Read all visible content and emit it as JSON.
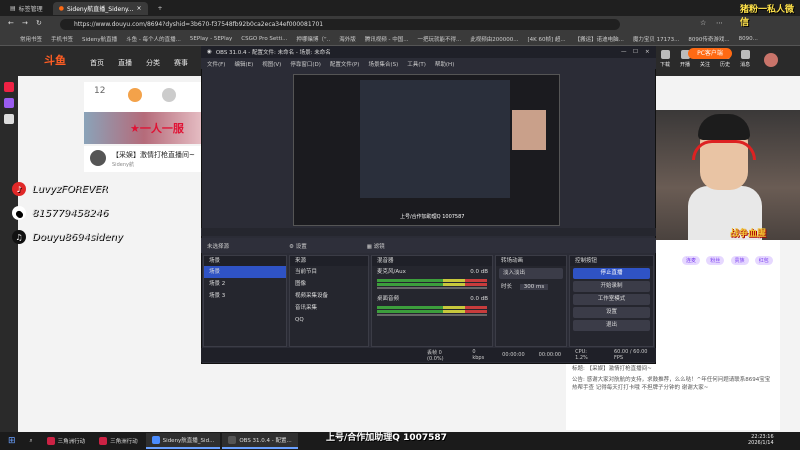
{
  "browser": {
    "tabs": [
      {
        "label": "标签管理"
      },
      {
        "label": "Sideny航直播_Sideny..."
      }
    ],
    "url": "https://www.douyu.com/8694?dyshid=3b670-f37548fb92b0ca2eca34ef000081701",
    "bookmarks": [
      "常用书签",
      "手机书签",
      "Sideny航直播",
      "斗鱼 - 每个人的直播...",
      "5EPlay - 5EPlay",
      "CSGO Pro Setti...",
      "押哪赌博（“..",
      "海外版",
      "腾讯视频 - 中国...",
      "一把玩就能不得...",
      "此视频由200000...",
      "[4K 60帧] 超...",
      "【搬运】诺迪电脑...",
      "魔力宝贝 17173...",
      "8090传奇游戏...",
      "8090..."
    ]
  },
  "site": {
    "logo": "斗鱼",
    "nav": [
      "首页",
      "直播",
      "分类",
      "赛事"
    ],
    "right_nav": [
      "下载",
      "开播",
      "关注",
      "历史",
      "消息"
    ],
    "pc_button": "PC客户端",
    "room_level": "12",
    "room_title": "【采娱】激情打枪直播间~",
    "host_name": "Sideny航",
    "banner_text": "★一人一服"
  },
  "overlay": {
    "top_right": "猪粉一私人微信",
    "socials": [
      {
        "icon": "netease-music-icon",
        "text": "LuvyzFOREVER",
        "color": "#e02828"
      },
      {
        "icon": "penguin-icon",
        "text": "815779458246",
        "color": "#ffffff"
      },
      {
        "icon": "tiktok-icon",
        "text": "Douyu8694sideny",
        "color": "#111111"
      }
    ],
    "cam_text": "战争血腥",
    "bottom": "上号/合作加助理Q 1007587"
  },
  "obs": {
    "title": "OBS 31.0.4 - 配置文件: 未命名 - 场景: 未命名",
    "menu": [
      "文件(F)",
      "编辑(E)",
      "视图(V)",
      "停靠窗口(D)",
      "配置文件(P)",
      "场景集合(S)",
      "工具(T)",
      "帮助(H)"
    ],
    "no_source": "未选择源",
    "props": "设置",
    "filters": "滤镜",
    "docks": {
      "scenes": {
        "title": "场景",
        "items": [
          "场景",
          "场景 2",
          "场景 3"
        ]
      },
      "sources": {
        "title": "来源",
        "items": [
          "当前节目",
          "图像",
          "视频采集设备",
          "音讯采集",
          "QQ"
        ]
      },
      "mixer": {
        "title": "混音器",
        "channels": [
          {
            "name": "麦克风/Aux",
            "db": "0.0 dB"
          },
          {
            "name": "桌面音频",
            "db": "0.0 dB"
          }
        ]
      },
      "transitions": {
        "title": "转场动画",
        "mode": "淡入淡出",
        "duration_label": "时长",
        "duration": "300 ms"
      },
      "controls": {
        "title": "控制按钮",
        "buttons": [
          "停止直播",
          "开始录制",
          "工作室模式",
          "设置",
          "退出"
        ]
      }
    },
    "status": {
      "dropped": "丢帧 0 (0.0%)",
      "bitrate": "0 kbps",
      "rec": "00:00:00",
      "live": "00:00:00",
      "cpu": "CPU: 1.2%",
      "fps": "60.00 / 60.00 FPS"
    }
  },
  "chat": {
    "lines": [
      "主播: Sideny航",
      "标题: 【采娱】激情打枪直播间~",
      "公告: 感谢大家对航航的支持，求鼓推荐，么么哒！^年任何问题请联系8694宝宝热帮手查 记得每天打打卡哦 不担牌子分钟的 谢谢大家~"
    ],
    "badges": [
      "连麦",
      "粉丝",
      "贵族",
      "红包"
    ]
  },
  "taskbar": {
    "items": [
      {
        "label": "三角洲行动"
      },
      {
        "label": "三角洲行动"
      },
      {
        "label": "Sideny航直播_Sid..."
      },
      {
        "label": "OBS 31.0.4 - 配置..."
      }
    ],
    "time": "22:23:16",
    "date": "2026/1/14"
  }
}
